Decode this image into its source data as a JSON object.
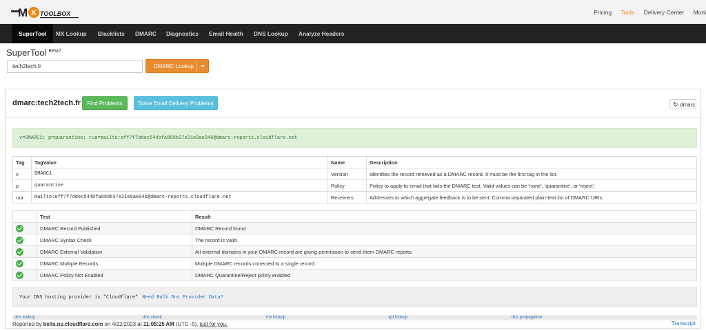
{
  "logo": {
    "text": "TOOLBOX",
    "mark": "MX"
  },
  "header": {
    "links": [
      "Pricing",
      "Tools",
      "Delivery Center",
      "Moni"
    ],
    "active_link": "Tools"
  },
  "nav": {
    "items": [
      "SuperTool",
      "MX Lookup",
      "Blacklists",
      "DMARC",
      "Diagnostics",
      "Email Health",
      "DNS Lookup",
      "Analyze Headers"
    ],
    "active": "SuperTool"
  },
  "supertool": {
    "title": "SuperTool",
    "badge": "Beta7",
    "input_value": "tech2tech.fr",
    "button_label": "DMARC Lookup"
  },
  "result": {
    "title": "dmarc:tech2tech.fr",
    "find_problems": "Find Problems",
    "solve": "Solve Email Delivery Problems",
    "refresh_label": "dmarc",
    "record": "v=DMARC1;  p=quarantine; rua=mailto:eff7f7ddec544bfa889b37e21e9ae940@dmarc-reports.cloudflare.net"
  },
  "tag_table": {
    "headers": [
      "Tag",
      "TagValue",
      "Name",
      "Description"
    ],
    "rows": [
      [
        "v",
        "DMARC1",
        "Version",
        "Identifies the record retrieved as a DMARC record. It must be the first tag in the list."
      ],
      [
        "p",
        "quarantine",
        "Policy",
        "Policy to apply to email that fails the DMARC test. Valid values can be 'none', 'quarantine', or 'reject'."
      ],
      [
        "rua",
        "mailto:eff7f7ddec544bfa889b37e21e9ae940@dmarc-reports.cloudflare.net",
        "Receivers",
        "Addresses to which aggregate feedback is to be sent. Comma separated plain-text list of DMARC URIs."
      ]
    ]
  },
  "test_table": {
    "headers": [
      "",
      "Test",
      "Result"
    ],
    "rows": [
      [
        "DMARC Record Published",
        "DMARC Record found"
      ],
      [
        "DMARC Syntax Check",
        "The record is valid"
      ],
      [
        "DMARC External Validation",
        "All external domains in your DMARC record are giving permission to send them DMARC reports."
      ],
      [
        "DMARC Multiple Records",
        "Multiple DMARC records corrected to a single record."
      ],
      [
        "DMARC Policy Not Enabled",
        "DMARC Quarantine/Reject policy enabled"
      ]
    ],
    "status_color": "#4cae4c"
  },
  "dns_info": {
    "text": "Your DNS hosting provider is \"Cloudflare\"",
    "link": "Need Bulk Dns Provider Data?"
  },
  "footer_links": [
    "dns lookup",
    "dns check",
    "mx lookup",
    "spf lookup",
    "dns propagation"
  ],
  "report": {
    "prefix": "Reported by",
    "server": "bella.ns.cloudflare.com",
    "on": "on 4/22/2023 at",
    "time": "11:08:25 AM",
    "tz": "(UTC -5),",
    "just_for_you": "just for you."
  },
  "transcript": "Transcript"
}
